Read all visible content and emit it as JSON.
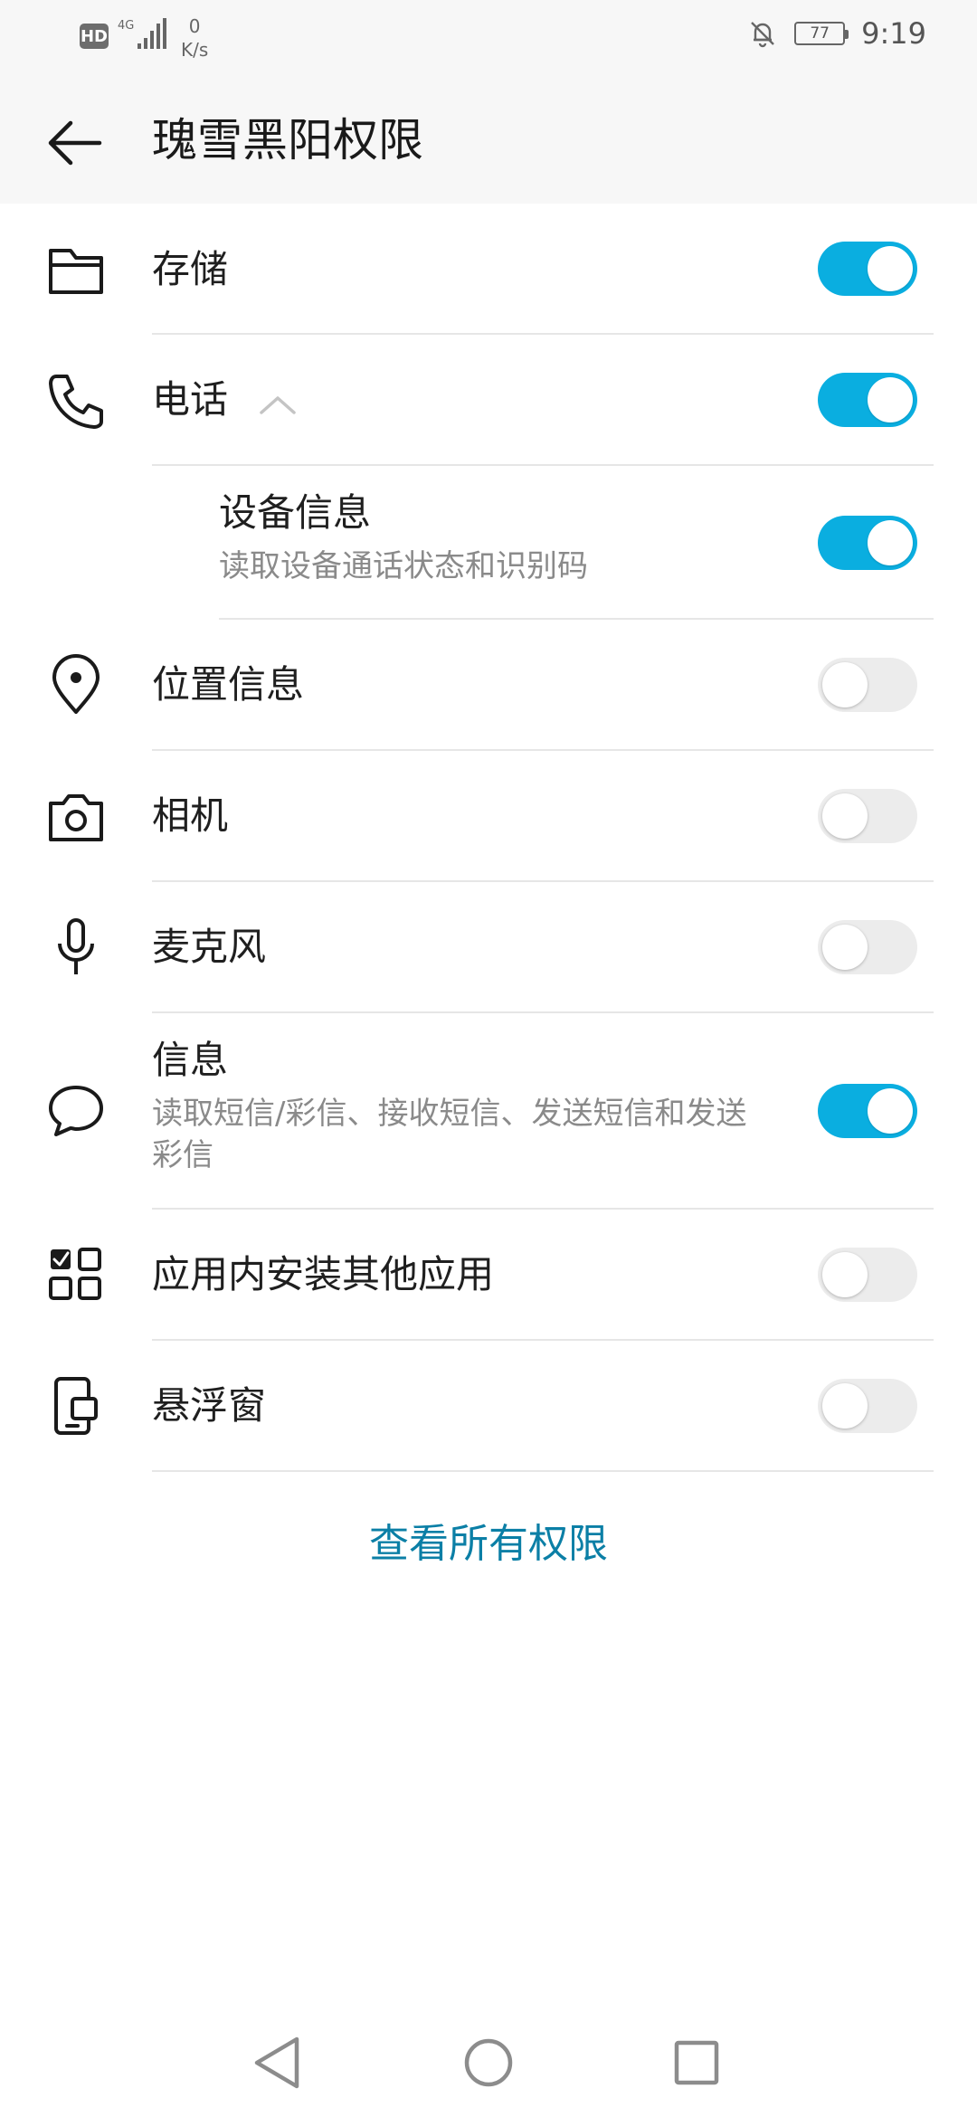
{
  "status_bar": {
    "hd_label": "HD",
    "network_label": "4G",
    "speed_value": "0",
    "speed_unit": "K/s",
    "battery_level": "77",
    "time": "9:19"
  },
  "app_bar": {
    "title": "瑰雪黑阳权限"
  },
  "permissions": [
    {
      "label": "存储",
      "enabled": true,
      "icon": "folder-icon"
    },
    {
      "label": "电话",
      "enabled": true,
      "icon": "phone-icon",
      "expanded": true
    },
    {
      "label": "设备信息",
      "sublabel": "读取设备通话状态和识别码",
      "enabled": true
    },
    {
      "label": "位置信息",
      "enabled": false,
      "icon": "location-pin-icon"
    },
    {
      "label": "相机",
      "enabled": false,
      "icon": "camera-icon"
    },
    {
      "label": "麦克风",
      "enabled": false,
      "icon": "microphone-icon"
    },
    {
      "label": "信息",
      "sublabel": "读取短信/彩信、接收短信、发送短信和发送彩信",
      "enabled": true,
      "icon": "message-bubble-icon"
    },
    {
      "label": "应用内安装其他应用",
      "enabled": false,
      "icon": "app-grid-icon"
    },
    {
      "label": "悬浮窗",
      "enabled": false,
      "icon": "floating-window-icon"
    }
  ],
  "view_all_label": "查看所有权限",
  "colors": {
    "toggle_on": "#0aaee0",
    "toggle_off": "#ececec",
    "link": "#0b7fa6"
  }
}
